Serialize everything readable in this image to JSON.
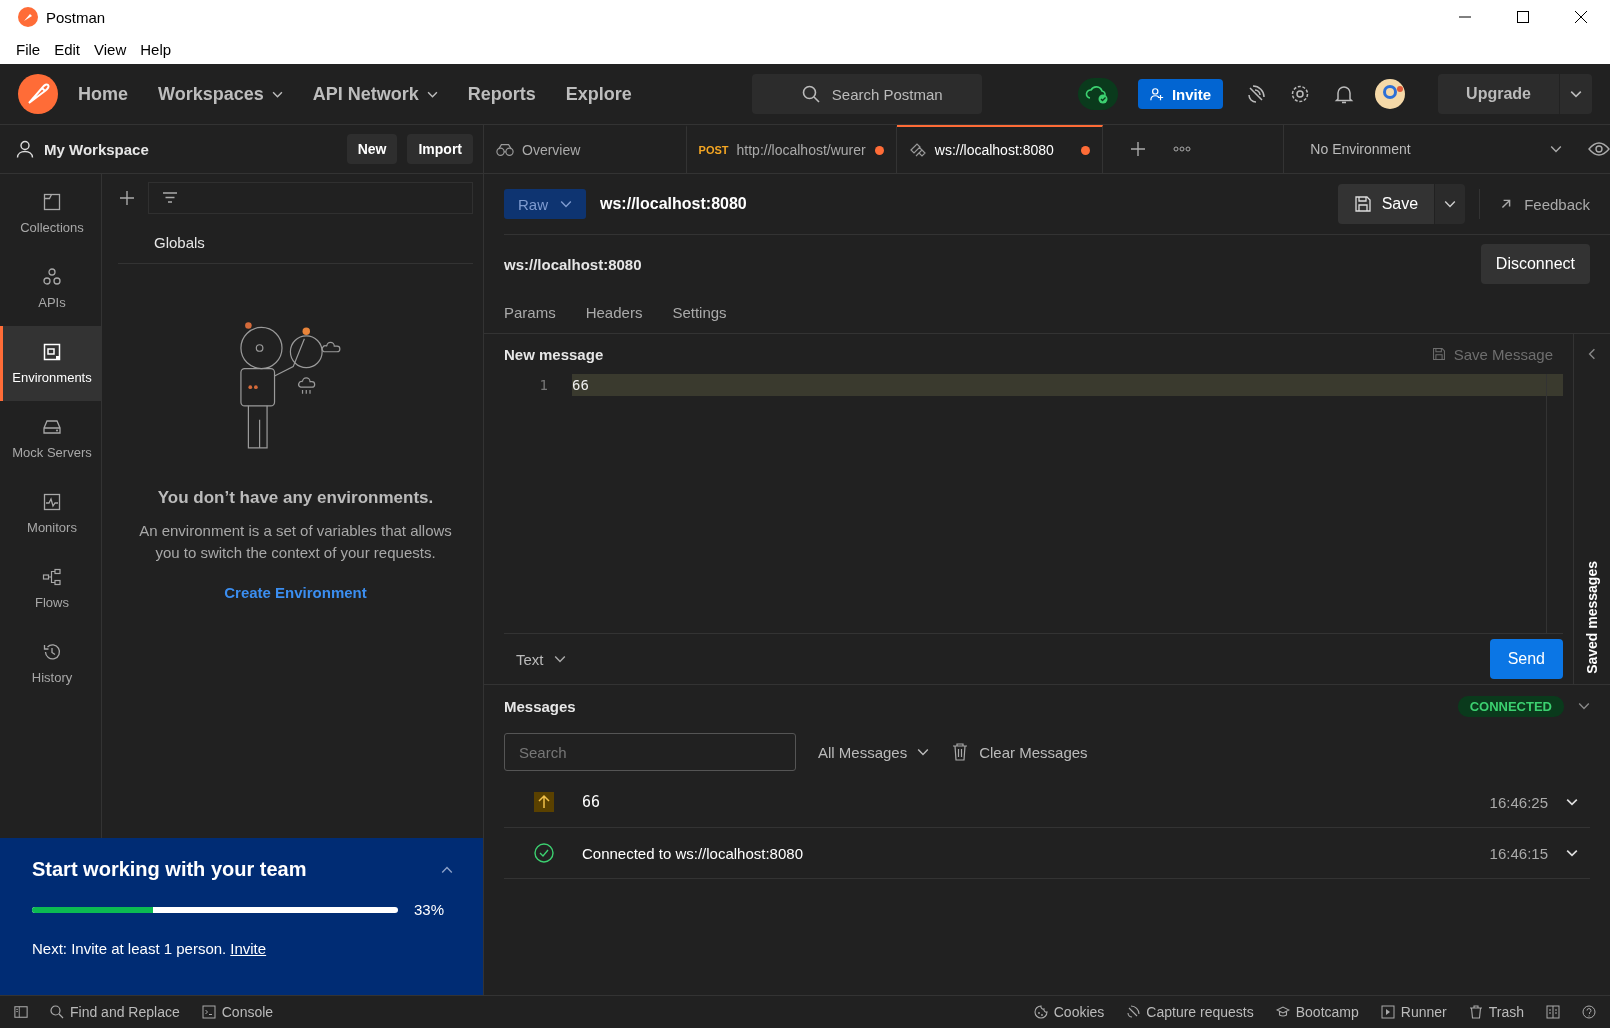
{
  "window": {
    "title": "Postman"
  },
  "menu": [
    "File",
    "Edit",
    "View",
    "Help"
  ],
  "nav": [
    {
      "label": "Home",
      "dropdown": false
    },
    {
      "label": "Workspaces",
      "dropdown": true
    },
    {
      "label": "API Network",
      "dropdown": true
    },
    {
      "label": "Reports",
      "dropdown": false
    },
    {
      "label": "Explore",
      "dropdown": false
    }
  ],
  "search": {
    "placeholder": "Search Postman"
  },
  "invite": "Invite",
  "upgrade": "Upgrade",
  "workspace": {
    "name": "My Workspace",
    "buttons": [
      "New",
      "Import"
    ]
  },
  "sidebar": {
    "items": [
      {
        "kind": "collections",
        "label": "Collections",
        "selected": false
      },
      {
        "kind": "apis",
        "label": "APIs",
        "selected": false
      },
      {
        "kind": "environments",
        "label": "Environments",
        "selected": true
      },
      {
        "kind": "mock",
        "label": "Mock Servers",
        "selected": false
      },
      {
        "kind": "monitors",
        "label": "Monitors",
        "selected": false
      },
      {
        "kind": "flows",
        "label": "Flows",
        "selected": false
      },
      {
        "kind": "history",
        "label": "History",
        "selected": false
      }
    ]
  },
  "environments": {
    "globals": "Globals",
    "empty_title": "You don’t have any environments.",
    "empty_text": "An environment is a set of variables that allows you to switch the context of your requests.",
    "create": "Create Environment"
  },
  "team": {
    "title": "Start working with your team",
    "level": 0.33,
    "percent": "33%",
    "next": "Next: Invite at least 1 person.",
    "link": "Invite"
  },
  "tabs": [
    {
      "kind": "overview",
      "label": "Overview",
      "unsaved": false,
      "selected": false
    },
    {
      "kind": "http",
      "method": "POST",
      "label": "http://localhost/wurer",
      "unsaved": true,
      "selected": false
    },
    {
      "kind": "ws",
      "label": "ws://localhost:8080",
      "unsaved": true,
      "selected": true
    }
  ],
  "environment": "No Environment",
  "request": {
    "mode": "Raw",
    "url": "ws://localhost:8080",
    "save": "Save",
    "feedback": "Feedback",
    "title": "ws://localhost:8080",
    "disconnect": "Disconnect",
    "subtabs": [
      {
        "label": "Params",
        "selected": false
      },
      {
        "label": "Headers",
        "selected": false
      },
      {
        "label": "Settings",
        "selected": false
      }
    ]
  },
  "composer": {
    "title": "New message",
    "save_message": "Save Message",
    "save_disabled": true,
    "lines": [
      {
        "number": "1",
        "text": "66"
      }
    ],
    "format": "Text",
    "send": "Send",
    "saved": "Saved messages"
  },
  "messages": {
    "title": "Messages",
    "status": "CONNECTED",
    "search_placeholder": "Search",
    "filter": "All Messages",
    "clear": "Clear Messages",
    "items": [
      {
        "kind": "sent",
        "text": "66",
        "time": "16:46:25"
      },
      {
        "kind": "connected",
        "text": "Connected to ws://localhost:8080",
        "time": "16:46:15"
      }
    ]
  },
  "status_bar": {
    "left": [
      {
        "kind": "find",
        "label": "Find and Replace"
      },
      {
        "kind": "console",
        "label": "Console"
      }
    ],
    "right": [
      {
        "kind": "cookies",
        "label": "Cookies"
      },
      {
        "kind": "capture",
        "label": "Capture requests"
      },
      {
        "kind": "bootcamp",
        "label": "Bootcamp"
      },
      {
        "kind": "runner",
        "label": "Runner"
      },
      {
        "kind": "trash",
        "label": "Trash"
      }
    ]
  }
}
